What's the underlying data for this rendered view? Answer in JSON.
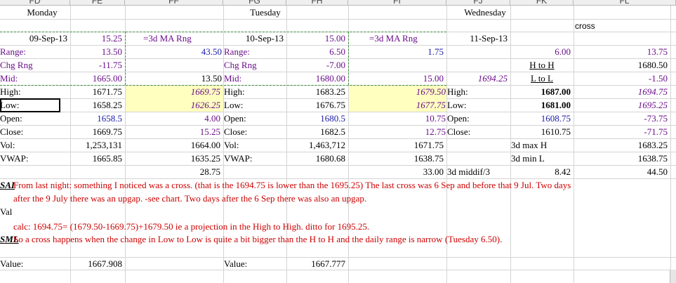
{
  "columns": [
    "FD",
    "FE",
    "FF",
    "FG",
    "FH",
    "FI",
    "FJ",
    "FK",
    "FL"
  ],
  "days": {
    "monday": "Monday",
    "tuesday": "Tuesday",
    "wednesday": "Wednesday"
  },
  "cross_label": "cross",
  "monday": {
    "date": "09-Sep-13",
    "date_val": "15.25",
    "ma_label": "=3d MA Rng",
    "range_val": "13.50",
    "ma_range": "43.50",
    "chg_val": "-11.75",
    "mid_val": "1665.00",
    "mid_extra": "13.50",
    "high_val": "1671.75",
    "high_proj": "1669.75",
    "low_val": "1658.25",
    "low_proj": "1626.25",
    "open_val": "1658.5",
    "open_extra": "4.00",
    "close_val": "1669.75",
    "close_extra": "15.25",
    "vol_val": "1,253,131",
    "vol_extra": "1664.00",
    "vwap_val": "1665.85",
    "vwap_extra": "1635.25",
    "extra_row": "28.75"
  },
  "tuesday": {
    "date": "10-Sep-13",
    "date_val": "15.00",
    "ma_label": "=3d MA Rng",
    "range_val": "6.50",
    "ma_range": "1.75",
    "chg_val": "-7.00",
    "mid_val": "1680.00",
    "mid_extra": "15.00",
    "mid_proj": "1694.25",
    "high_val": "1683.25",
    "high_proj": "1679.50",
    "low_val": "1676.75",
    "low_proj": "1677.75",
    "open_val": "1680.5",
    "open_extra": "10.75",
    "close_val": "1682.5",
    "close_extra": "12.75",
    "vol_val": "1,463,712",
    "vol_extra": "1671.75",
    "vwap_val": "1680.68",
    "vwap_extra": "1638.75",
    "extra_row": "33.00"
  },
  "wednesday": {
    "date": "11-Sep-13",
    "range_val": "6.00",
    "range_right": "13.75",
    "hh_label": "H to H",
    "hh_val": "1680.50",
    "ll_label": "L to L",
    "ll_val": "-1.50",
    "high_val": "1687.00",
    "high_proj": "1694.75",
    "low_val": "1681.00",
    "low_proj": "1695.25",
    "open_val": "1608.75",
    "open_extra": "-73.75",
    "close_val": "1610.75",
    "close_extra": "-71.75",
    "max_label": "3d max H",
    "max_val": "1683.25",
    "min_label": "3d min L",
    "min_val": "1638.75",
    "middif_label": "3d middif/3",
    "middif_val": "8.42",
    "middif_right": "44.50"
  },
  "labels": {
    "range": "Range:",
    "chg": "Chg Rng",
    "mid": "Mid:",
    "high": "High:",
    "low": "Low:",
    "open": "Open:",
    "close": "Close:",
    "vol": "Vol:",
    "vwap": "VWAP:",
    "value": "Value:"
  },
  "notes": {
    "sai_tag": "SAI",
    "line1": "From last night: something I noticed was a cross. (that is the 1694.75 is lower than the 1695.25) The last cross was 6 Sep and before that 9 Jul. Two days",
    "line2": "after the 9 July there was an upgap. -see chart. Two days after the 6 Sep there was also an upgap.",
    "val_tag": "Val",
    "line3": "calc: 1694.75= (1679.50-1669.75)+1679.50 ie a projection in the High to High. ditto for 1695.25.",
    "sml_tag": "SML",
    "line4": "So a cross happens when the change in Low to Low is quite a bit bigger than the H to H and the daily range is narrow (Tuesday 6.50)."
  },
  "values_row": {
    "value1": "1667.908",
    "value2": "1667.777"
  },
  "colors": {
    "blue": "#1a1aa6",
    "purple": "#6a0d8a",
    "red": "#cc0000",
    "highlight": "#ffffc0",
    "dash": "#3c8c3c"
  }
}
